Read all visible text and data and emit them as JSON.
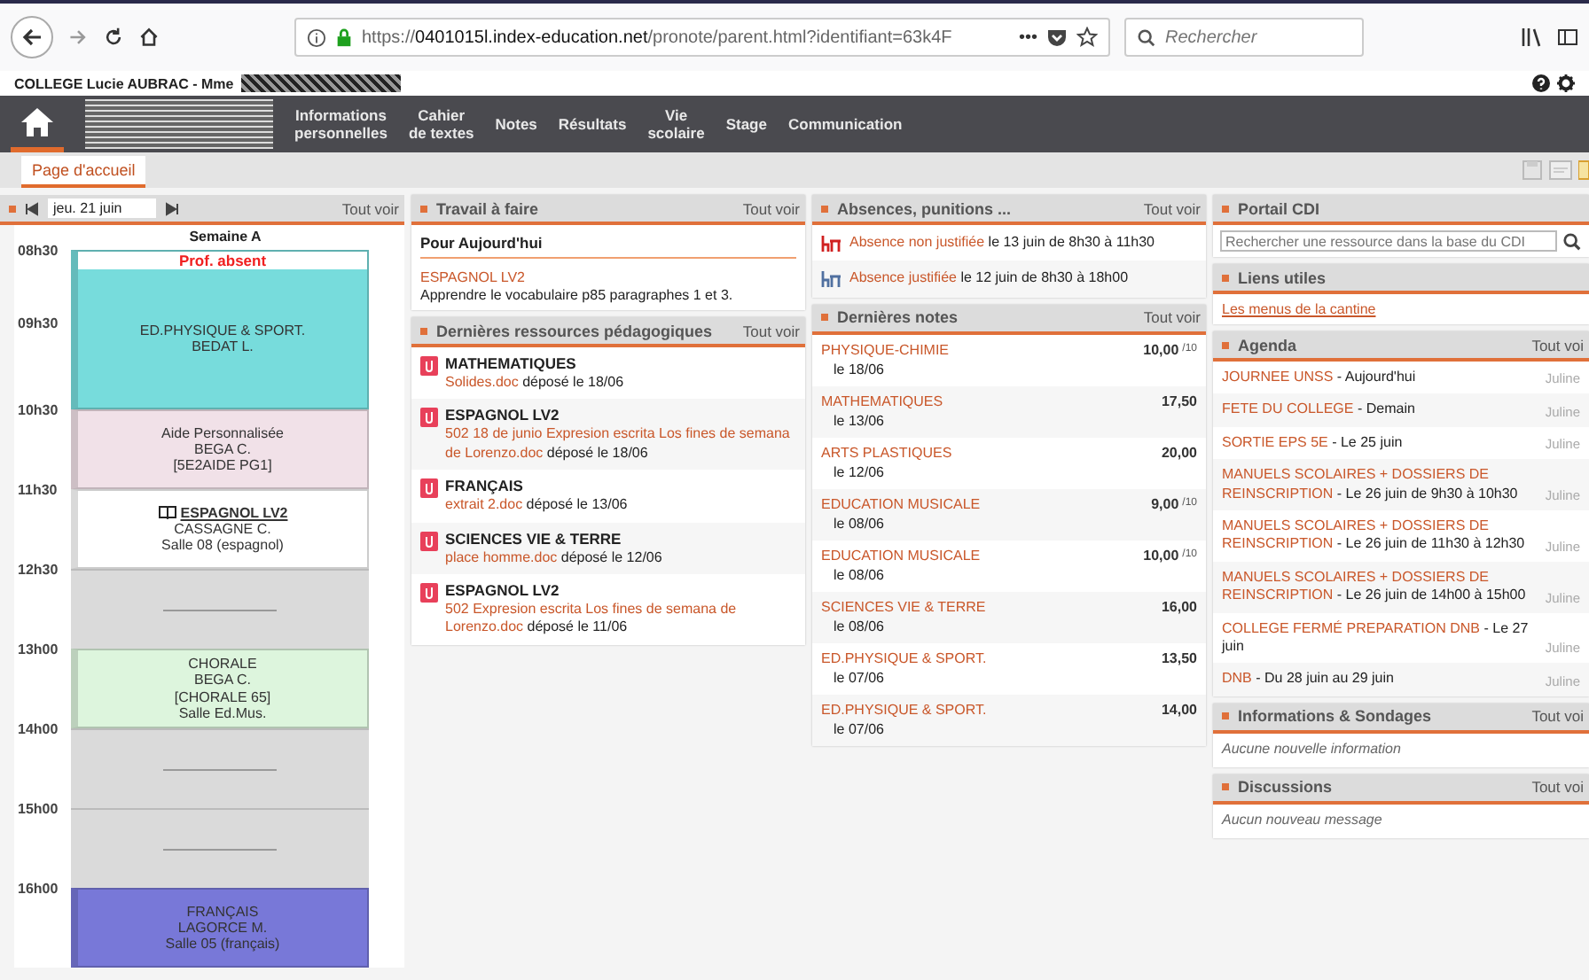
{
  "browser": {
    "url_host": "0401015l.index-education.net",
    "url_before": "https://",
    "url_after": "/pronote/parent.html?identifiant=63k4F",
    "more": "•••",
    "search_placeholder": "Rechercher"
  },
  "school": {
    "title": "COLLEGE Lucie AUBRAC - Mme"
  },
  "nav": {
    "items": [
      {
        "label": "Informations\npersonnelles"
      },
      {
        "label": "Cahier\nde textes"
      },
      {
        "label": "Notes"
      },
      {
        "label": "Résultats"
      },
      {
        "label": "Vie\nscolaire"
      },
      {
        "label": "Stage"
      },
      {
        "label": "Communication"
      }
    ]
  },
  "tabs": [
    {
      "label": "Page d'accueil",
      "selected": true
    }
  ],
  "schedule": {
    "date": "jeu. 21 juin",
    "see_all": "Tout voir",
    "week": "Semaine A",
    "slots": [
      {
        "kind": "course",
        "times": [
          "08h30",
          "09h30"
        ],
        "color": "#77dcdc",
        "status": "Prof. absent",
        "homework": false,
        "lines": [
          "ED.PHYSIQUE & SPORT.",
          "BEDAT L."
        ]
      },
      {
        "kind": "course",
        "times": [
          "10h30"
        ],
        "color": "#f1e1e8",
        "homework": false,
        "lines": [
          "Aide Personnalisée",
          "BEGA C.",
          "[5E2AIDE PG1]"
        ]
      },
      {
        "kind": "course",
        "times": [
          "11h30"
        ],
        "color": "#ffffff",
        "homework": true,
        "lines": [
          "ESPAGNOL LV2",
          "CASSAGNE C.",
          "Salle 08 (espagnol)"
        ]
      },
      {
        "kind": "empty",
        "times": [
          "12h30"
        ]
      },
      {
        "kind": "course",
        "times": [
          "13h00"
        ],
        "color": "#ddf5dd",
        "homework": false,
        "lines": [
          "CHORALE",
          "BEGA C.",
          "[CHORALE 65]",
          "Salle Ed.Mus."
        ]
      },
      {
        "kind": "empty",
        "times": [
          "14h00"
        ]
      },
      {
        "kind": "empty",
        "times": [
          "15h00"
        ]
      },
      {
        "kind": "course",
        "times": [
          "16h00"
        ],
        "color": "#7878d8",
        "homework": false,
        "lines": [
          "FRANÇAIS",
          "LAGORCE M.",
          "Salle 05 (français)"
        ]
      }
    ]
  },
  "homework": {
    "title": "Travail à faire",
    "see_all": "Tout voir",
    "day": "Pour Aujourd'hui",
    "items": [
      {
        "subject": "ESPAGNOL LV2",
        "text": "Apprendre le vocabulaire p85 paragraphes 1 et 3."
      }
    ]
  },
  "resources": {
    "title": "Dernières ressources pédagogiques",
    "see_all": "Tout voir",
    "items": [
      {
        "subject": "MATHEMATIQUES",
        "file": "Solides.doc",
        "deposit": "déposé le 18/06"
      },
      {
        "subject": "ESPAGNOL LV2",
        "file": "502 18 de junio Expresion escrita Los fines de semana de Lorenzo.doc",
        "deposit": "déposé le 18/06"
      },
      {
        "subject": "FRANÇAIS",
        "file": "extrait 2.doc",
        "deposit": "déposé le 13/06"
      },
      {
        "subject": "SCIENCES VIE & TERRE",
        "file": "place homme.doc",
        "deposit": "déposé le 12/06"
      },
      {
        "subject": "ESPAGNOL LV2",
        "file": "502 Expresion escrita Los fines de semana de Lorenzo.doc",
        "deposit": "déposé le 11/06"
      }
    ]
  },
  "absences": {
    "title": "Absences, punitions ...",
    "see_all": "Tout voir",
    "items": [
      {
        "kind": "unjustified",
        "label": "Absence non justifiée",
        "detail": "le 13 juin de 8h30 à 11h30"
      },
      {
        "kind": "justified",
        "label": "Absence justifiée",
        "detail": "le 12 juin de 8h30 à 18h00"
      }
    ]
  },
  "grades": {
    "title": "Dernières notes",
    "see_all": "Tout voir",
    "items": [
      {
        "subject": "PHYSIQUE-CHIMIE",
        "date": "le 18/06",
        "grade": "10,00",
        "scale": "/10"
      },
      {
        "subject": "MATHEMATIQUES",
        "date": "le 13/06",
        "grade": "17,50"
      },
      {
        "subject": "ARTS PLASTIQUES",
        "date": "le 12/06",
        "grade": "20,00"
      },
      {
        "subject": "EDUCATION MUSICALE",
        "date": "le 08/06",
        "grade": "9,00",
        "scale": "/10"
      },
      {
        "subject": "EDUCATION MUSICALE",
        "date": "le 08/06",
        "grade": "10,00",
        "scale": "/10"
      },
      {
        "subject": "SCIENCES VIE & TERRE",
        "date": "le 08/06",
        "grade": "16,00"
      },
      {
        "subject": "ED.PHYSIQUE & SPORT.",
        "date": "le 07/06",
        "grade": "13,50"
      },
      {
        "subject": "ED.PHYSIQUE & SPORT.",
        "date": "le 07/06",
        "grade": "14,00"
      }
    ]
  },
  "cdi": {
    "title": "Portail CDI",
    "placeholder": "Rechercher une ressource dans la base du CDI"
  },
  "links": {
    "title": "Liens utiles",
    "items": [
      "Les menus de la cantine"
    ]
  },
  "agenda": {
    "title": "Agenda",
    "see_all": "Tout voi",
    "items": [
      {
        "title": "JOURNEE UNSS",
        "when": "- Aujourd'hui",
        "author": "Juline"
      },
      {
        "title": "FETE DU COLLEGE",
        "when": "- Demain",
        "author": "Juline"
      },
      {
        "title": "SORTIE EPS 5E",
        "when": "- Le 25 juin",
        "author": "Juline"
      },
      {
        "title": "MANUELS SCOLAIRES + DOSSIERS DE REINSCRIPTION",
        "when": "- Le 26 juin de 9h30 à 10h30",
        "author": "Juline"
      },
      {
        "title": "MANUELS SCOLAIRES + DOSSIERS DE REINSCRIPTION",
        "when": "- Le 26 juin de 11h30 à 12h30",
        "author": "Juline"
      },
      {
        "title": "MANUELS SCOLAIRES + DOSSIERS DE REINSCRIPTION",
        "when": "- Le 26 juin de 14h00 à 15h00",
        "author": "Juline"
      },
      {
        "title": "COLLEGE FERMÉ PREPARATION DNB",
        "when": "- Le 27 juin",
        "author": "Juline"
      },
      {
        "title": "DNB",
        "when": "- Du 28 juin au 29 juin",
        "author": "Juline"
      }
    ]
  },
  "info": {
    "title": "Informations & Sondages",
    "see_all": "Tout voi",
    "empty": "Aucune nouvelle information"
  },
  "discussions": {
    "title": "Discussions",
    "see_all": "Tout voi",
    "empty": "Aucun nouveau message"
  }
}
